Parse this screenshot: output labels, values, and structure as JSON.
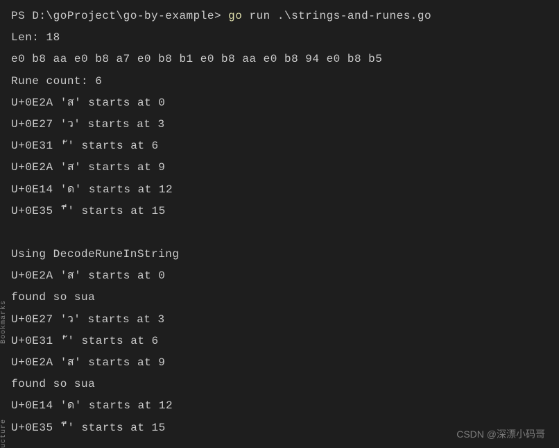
{
  "prompt": {
    "ps": "PS ",
    "path": "D:\\goProject\\go-by-example> ",
    "cmd_go": "go",
    "cmd_args": " run .\\strings-and-runes.go"
  },
  "output_lines": {
    "l1": "Len:  18",
    "l2": "e0 b8 aa e0 b8 a7 e0 b8 b1 e0 b8 aa e0 b8 94 e0 b8 b5",
    "l3": "Rune count: 6",
    "l4": "U+0E2A 'ส' starts at 0",
    "l5": "U+0E27 'ว' starts at 3",
    "l6": "U+0E31 'ั' starts at 6",
    "l7": "U+0E2A 'ส' starts at 9",
    "l8": "U+0E14 'ด' starts at 12",
    "l9": "U+0E35 'ี' starts at 15",
    "l10": "",
    "l11": "Using DecodeRuneInString",
    "l12": "U+0E2A 'ส' starts at 0",
    "l13": "found so sua",
    "l14": "U+0E27 'ว' starts at 3",
    "l15": "U+0E31 'ั' starts at 6",
    "l16": "U+0E2A 'ส' starts at 9",
    "l17": "found so sua",
    "l18": "U+0E14 'ด' starts at 12",
    "l19": "U+0E35 'ี' starts at 15"
  },
  "sidebar": {
    "bookmarks": "Bookmarks",
    "ucture": "ucture"
  },
  "watermark": "CSDN @深漂小码哥"
}
